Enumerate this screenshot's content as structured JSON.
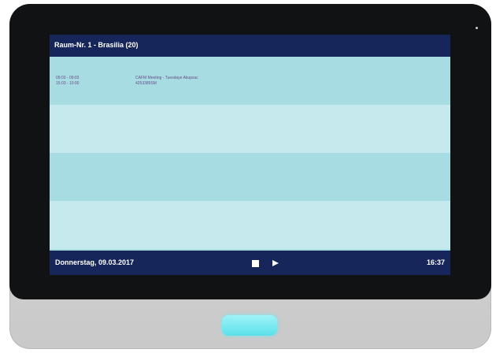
{
  "header": {
    "room_title": "Raum-Nr. 1 - Brasilia (20)"
  },
  "booking": {
    "times": [
      "09:03 - 09:03",
      "15:03 - 19:00"
    ],
    "details": [
      "CAFM Meeting - Tuesdaye Akupsac",
      "4253389SM"
    ]
  },
  "footer": {
    "date": "Donnerstag, 09.03.2017",
    "time": "16:37",
    "controls": [
      "stop-icon",
      "play-icon"
    ]
  },
  "colors": {
    "header_footer": "#16265a",
    "row_dark": "#a7dde2",
    "row_light": "#c5e9ec",
    "booking_text": "#6a4a8a",
    "home_button": "#5be0ea"
  }
}
